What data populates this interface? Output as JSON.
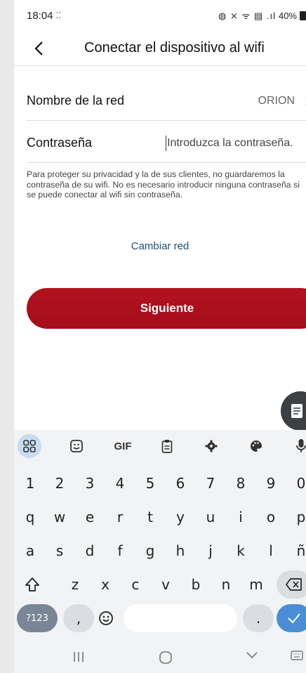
{
  "status_bar": {
    "time": "18:04",
    "left_extra": "⁚⁚",
    "icons": "◍ ⨯ ᯤ ▤ .ıl",
    "battery": "40%"
  },
  "header": {
    "title": "Conectar el dispositivo al wifi"
  },
  "form": {
    "network_label": "Nombre de la red",
    "network_value": "ORION",
    "password_label": "Contraseña",
    "password_placeholder": "Introduzca la contraseña."
  },
  "privacy_text": "Para proteger su privacidad y la de sus clientes, no guardaremos la contraseña de su wifi. No es necesario introducir ninguna contraseña si se puede conectar al wifi sin contraseña.",
  "change_network_label": "Cambiar red",
  "next_button_label": "Siguiente",
  "keyboard": {
    "toolbar": [
      "apps-grid",
      "sticker",
      "GIF",
      "clipboard",
      "settings",
      "palette",
      "mic"
    ],
    "gif_label": "GIF",
    "number_row": [
      "1",
      "2",
      "3",
      "4",
      "5",
      "6",
      "7",
      "8",
      "9",
      "0"
    ],
    "row1": [
      "q",
      "w",
      "e",
      "r",
      "t",
      "y",
      "u",
      "i",
      "o",
      "p"
    ],
    "row2": [
      "a",
      "s",
      "d",
      "f",
      "g",
      "h",
      "j",
      "k",
      "l",
      "ñ"
    ],
    "row3": [
      "z",
      "x",
      "c",
      "v",
      "b",
      "n",
      "m"
    ],
    "num_mode_label": "?123",
    "comma": ",",
    "period": "."
  },
  "colors": {
    "accent_red": "#b3121f",
    "link_blue": "#1f4f7a",
    "enter_blue": "#4a8fd6"
  }
}
